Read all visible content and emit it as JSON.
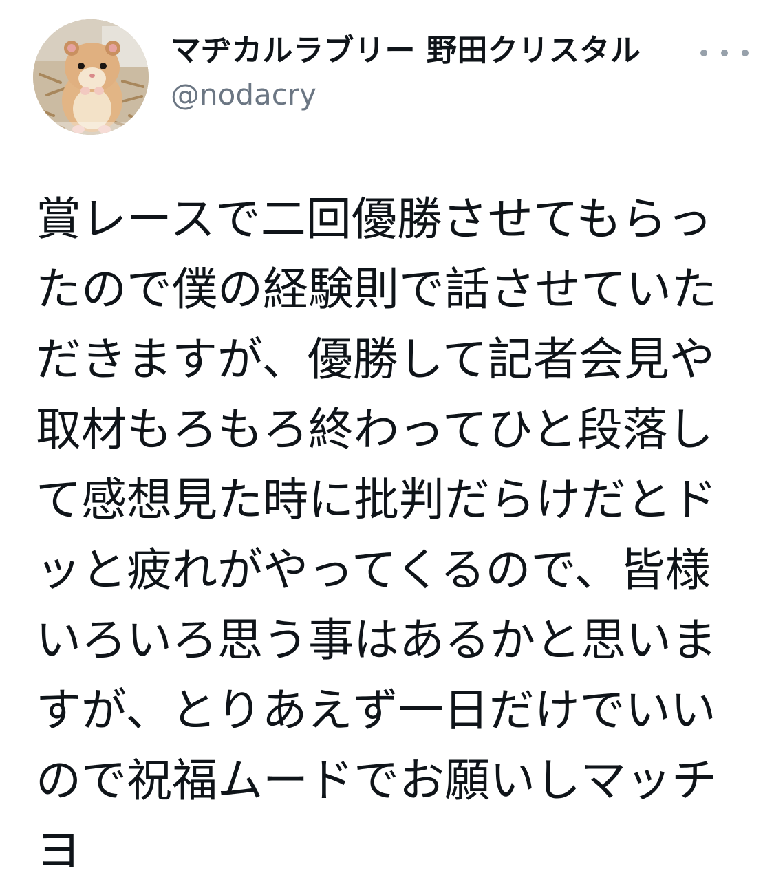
{
  "author": {
    "display_name": "マヂカルラブリー 野田クリスタル",
    "handle": "@nodacry",
    "avatar_icon": "hamster-avatar-icon"
  },
  "more_icon": "more-horizontal-icon",
  "tweet": {
    "lines": [
      "賞レースで二回優勝させてもらっ",
      "たので僕の経験則で話させていた",
      "だきますが、優勝して記者会見や",
      "取材もろもろ終わってひと段落し",
      "て感想見た時に批判だらけだとド",
      "ッと疲れがやってくるので、皆様",
      "いろいろ思う事はあるかと思いま",
      "すが、とりあえず一日だけでいい",
      "ので祝福ムードでお願いしマッチ",
      "ヨ"
    ]
  }
}
